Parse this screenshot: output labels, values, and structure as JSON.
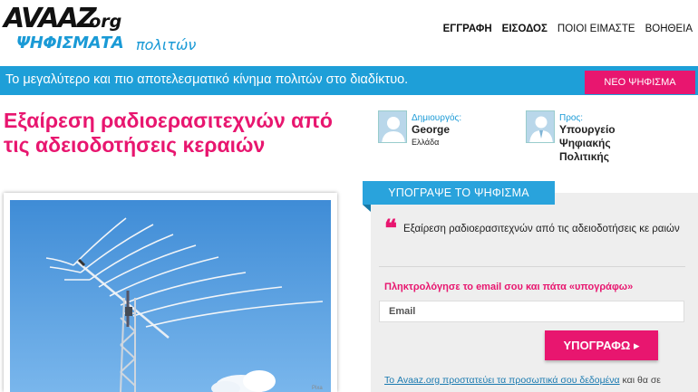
{
  "brand": {
    "name": "AVAAZ",
    "tld": ".org",
    "tagline_bold": "ΨΗΦΙΣΜΑΤΑ",
    "tagline_light": "πολιτών"
  },
  "topnav": [
    {
      "label": "ΕΓΓΡΑΦΗ",
      "bold": true
    },
    {
      "label": "ΕΙΣΟΔΟΣ",
      "bold": true
    },
    {
      "label": "ΠΟΙΟΙ ΕΙΜΑΣΤΕ",
      "bold": false
    },
    {
      "label": "ΒΟΗΘΕΙΑ",
      "bold": false
    }
  ],
  "band": {
    "text": "Το μεγαλύτερο και πιο αποτελεσματικό κίνημα πολιτών στο διαδίκτυο.",
    "new_petition_label": "ΝΕΟ ΨΗΦΙΣΜΑ"
  },
  "petition": {
    "title": "Εξαίρεση ραδιοερασιτεχνών από τις αδειοδοτήσεις κεραιών",
    "creator_label": "Δημιουργός:",
    "creator_name": "George",
    "creator_location": "Ελλάδα",
    "target_label": "Προς:",
    "target_name": "Υπουργείο Ψηφιακής Πολιτικής",
    "photo_caption": "Pixa"
  },
  "sign": {
    "header": "ΥΠΟΓΡΑΨΕ ΤΟ ΨΗΦΙΣΜΑ",
    "quote_mark": "❝",
    "quote_text": "Εξαίρεση ραδιοερασιτεχνών από τις αδειοδοτήσεις κε ραιών",
    "email_prompt": "Πληκτρολόγησε το email σου και πάτα «υπογράφω»",
    "email_placeholder": "Email",
    "button_label": "ΥΠΟΓΡΑΦΩ ▸",
    "privacy_link": "Το Avaaz.org προστατεύει τα προσωπικά σου δεδομένα",
    "privacy_rest": " και θα σε"
  },
  "colors": {
    "accent_pink": "#e8166f",
    "accent_blue": "#1e9fd8"
  }
}
